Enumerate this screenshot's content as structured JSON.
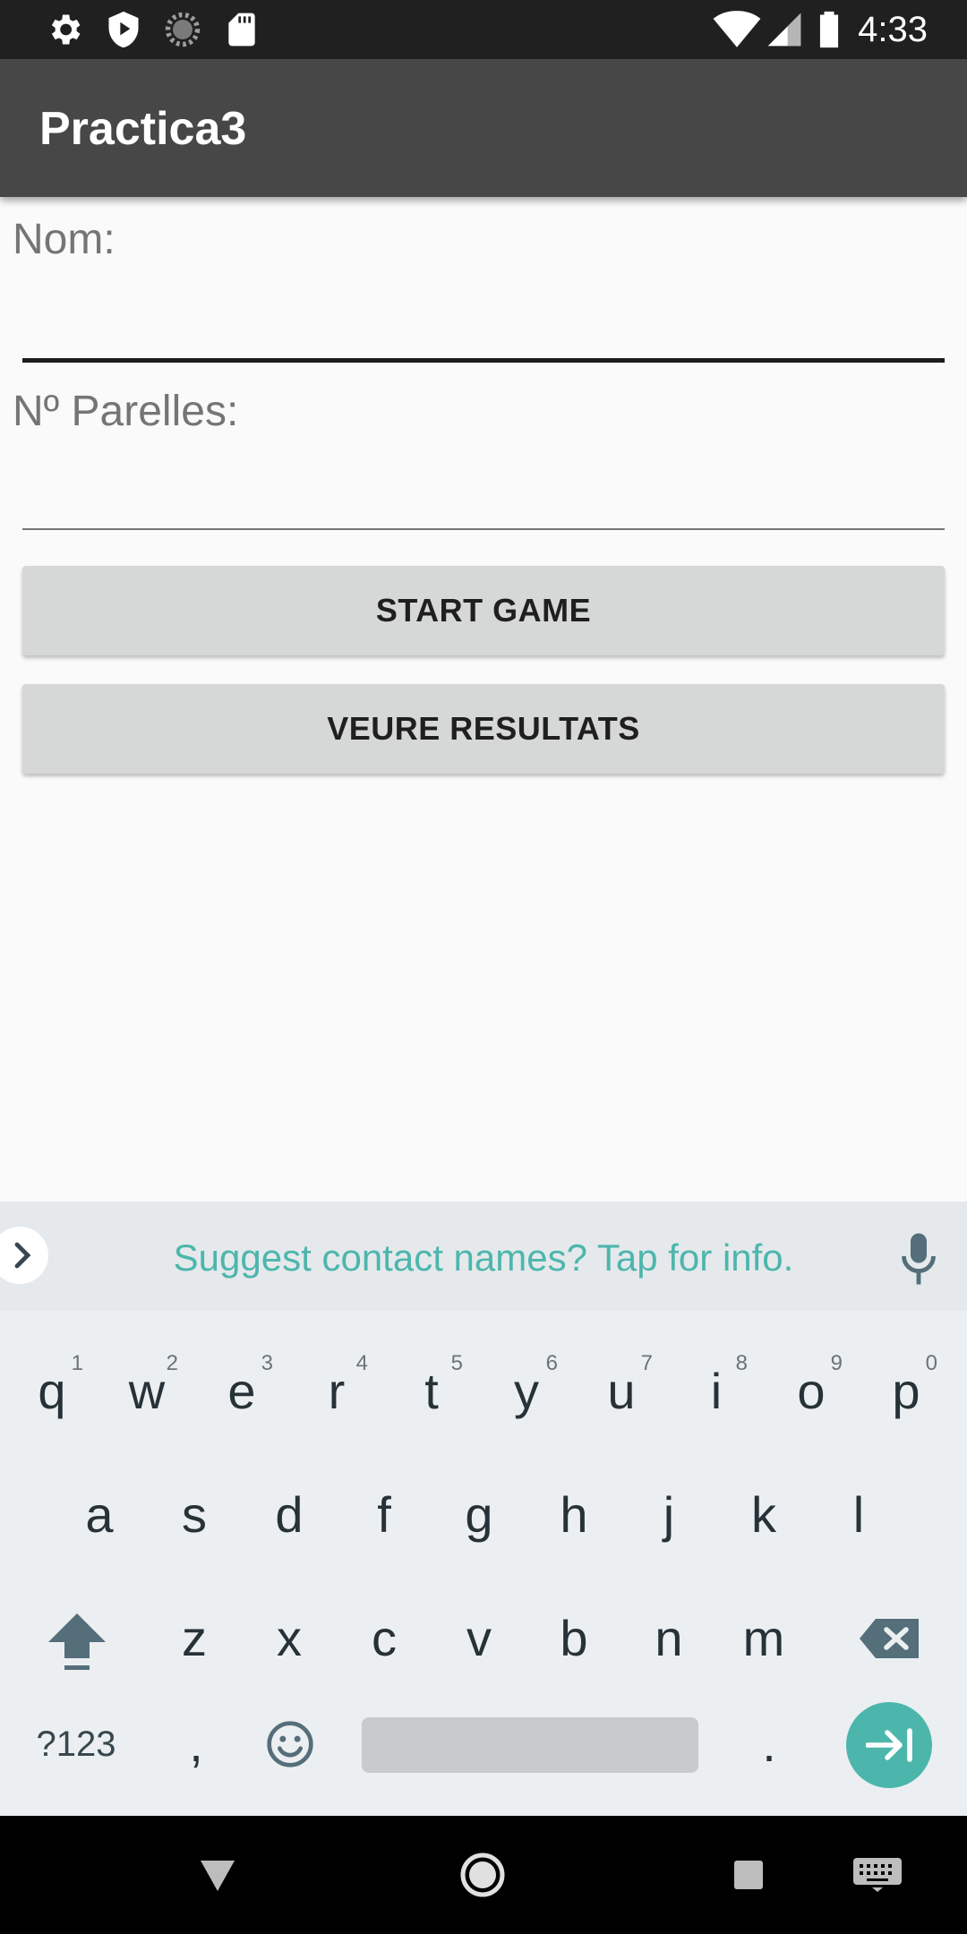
{
  "status_bar": {
    "time": "4:33",
    "left_icons": [
      "gear-icon",
      "shield-play-icon",
      "loading-icon",
      "sd-card-icon"
    ],
    "right_icons": [
      "wifi-icon",
      "signal-icon",
      "battery-icon"
    ]
  },
  "app_bar": {
    "title": "Practica3"
  },
  "form": {
    "name_label": "Nom:",
    "name_value": "",
    "pairs_label": "Nº Parelles:",
    "pairs_value": "",
    "start_button": "START GAME",
    "results_button": "VEURE RESULTATS"
  },
  "keyboard": {
    "suggestion": "Suggest contact names? Tap for info.",
    "row1": [
      {
        "key": "q",
        "hint": "1"
      },
      {
        "key": "w",
        "hint": "2"
      },
      {
        "key": "e",
        "hint": "3"
      },
      {
        "key": "r",
        "hint": "4"
      },
      {
        "key": "t",
        "hint": "5"
      },
      {
        "key": "y",
        "hint": "6"
      },
      {
        "key": "u",
        "hint": "7"
      },
      {
        "key": "i",
        "hint": "8"
      },
      {
        "key": "o",
        "hint": "9"
      },
      {
        "key": "p",
        "hint": "0"
      }
    ],
    "row2": [
      "a",
      "s",
      "d",
      "f",
      "g",
      "h",
      "j",
      "k",
      "l"
    ],
    "row3": [
      "z",
      "x",
      "c",
      "v",
      "b",
      "n",
      "m"
    ],
    "symbols_key": "?123",
    "comma_key": ",",
    "period_key": ".",
    "accent_color": "#4db6ac"
  },
  "nav_bar": {
    "icons": [
      "back-icon",
      "home-icon",
      "recents-icon",
      "keyboard-icon"
    ]
  }
}
